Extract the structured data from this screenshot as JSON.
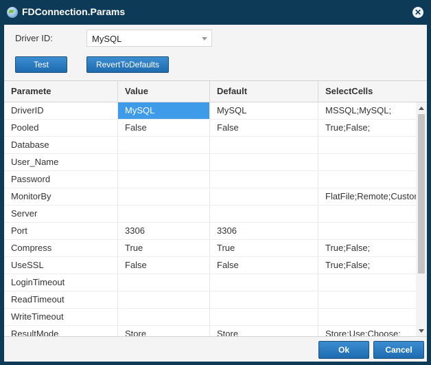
{
  "window": {
    "title": "FDConnection.Params",
    "icon": "globe-icon",
    "close_symbol": "✕"
  },
  "driver": {
    "label": "Driver ID:",
    "value": "MySQL"
  },
  "buttons": {
    "test": "Test",
    "revert": "RevertToDefaults",
    "ok": "Ok",
    "cancel": "Cancel"
  },
  "grid": {
    "columns": [
      "Paramete",
      "Value",
      "Default",
      "SelectCells"
    ],
    "rows": [
      [
        "DriverID",
        "MySQL",
        "MySQL",
        "MSSQL;MySQL;"
      ],
      [
        "Pooled",
        "False",
        "False",
        "True;False;"
      ],
      [
        "Database",
        "",
        "",
        ""
      ],
      [
        "User_Name",
        "",
        "",
        ""
      ],
      [
        "Password",
        "",
        "",
        ""
      ],
      [
        "MonitorBy",
        "",
        "",
        "FlatFile;Remote;Custom;"
      ],
      [
        "Server",
        "",
        "",
        ""
      ],
      [
        "Port",
        "3306",
        "3306",
        ""
      ],
      [
        "Compress",
        "True",
        "True",
        "True;False;"
      ],
      [
        "UseSSL",
        "False",
        "False",
        "True;False;"
      ],
      [
        "LoginTimeout",
        "",
        "",
        ""
      ],
      [
        "ReadTimeout",
        "",
        "",
        ""
      ],
      [
        "WriteTimeout",
        "",
        "",
        ""
      ],
      [
        "ResultMode",
        "Store",
        "Store",
        "Store;Use;Choose;"
      ]
    ],
    "selected": {
      "row": 0,
      "col": 1
    }
  },
  "colors": {
    "titlebar": "#0d3a56",
    "button": "#1e6bb0",
    "selection": "#3d9be9"
  }
}
